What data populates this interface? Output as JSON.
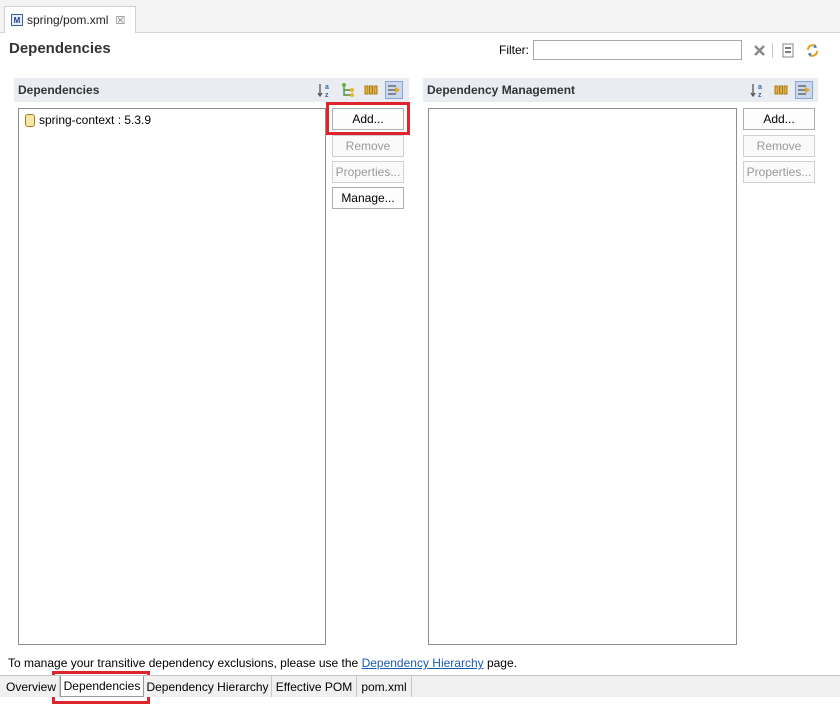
{
  "editor_tab": {
    "icon": "maven-pom-icon",
    "title": "spring/pom.xml",
    "close_glyph": "☒"
  },
  "header": {
    "title": "Dependencies",
    "filter_label": "Filter:",
    "filter_value": "",
    "icons": [
      "clear-filter-icon",
      "show-dependency-hierarchy-icon",
      "refresh-icon"
    ]
  },
  "dependencies_section": {
    "title": "Dependencies",
    "toolbar_icons": [
      "sort-alphabetically-icon",
      "show-group-id-icon",
      "show-classifier-icon",
      "show-inherited-icon"
    ],
    "items": [
      {
        "icon": "jar-icon",
        "label": "spring-context : 5.3.9"
      }
    ],
    "buttons": {
      "add": "Add...",
      "remove": "Remove",
      "properties": "Properties...",
      "manage": "Manage..."
    }
  },
  "dependency_management_section": {
    "title": "Dependency Management",
    "toolbar_icons": [
      "sort-alphabetically-icon",
      "show-classifier-icon",
      "show-inherited-icon"
    ],
    "items": [],
    "buttons": {
      "add": "Add...",
      "remove": "Remove",
      "properties": "Properties..."
    }
  },
  "footer": {
    "text_before": "To manage your transitive dependency exclusions, please use the ",
    "link": "Dependency Hierarchy",
    "text_after": " page."
  },
  "bottom_tabs": [
    "Overview",
    "Dependencies",
    "Dependency Hierarchy",
    "Effective POM",
    "pom.xml"
  ],
  "selected_bottom_tab": "Dependencies",
  "colors": {
    "highlight": "#e0242b",
    "section_header": "#e9edf2",
    "link": "#1a5bb6"
  }
}
